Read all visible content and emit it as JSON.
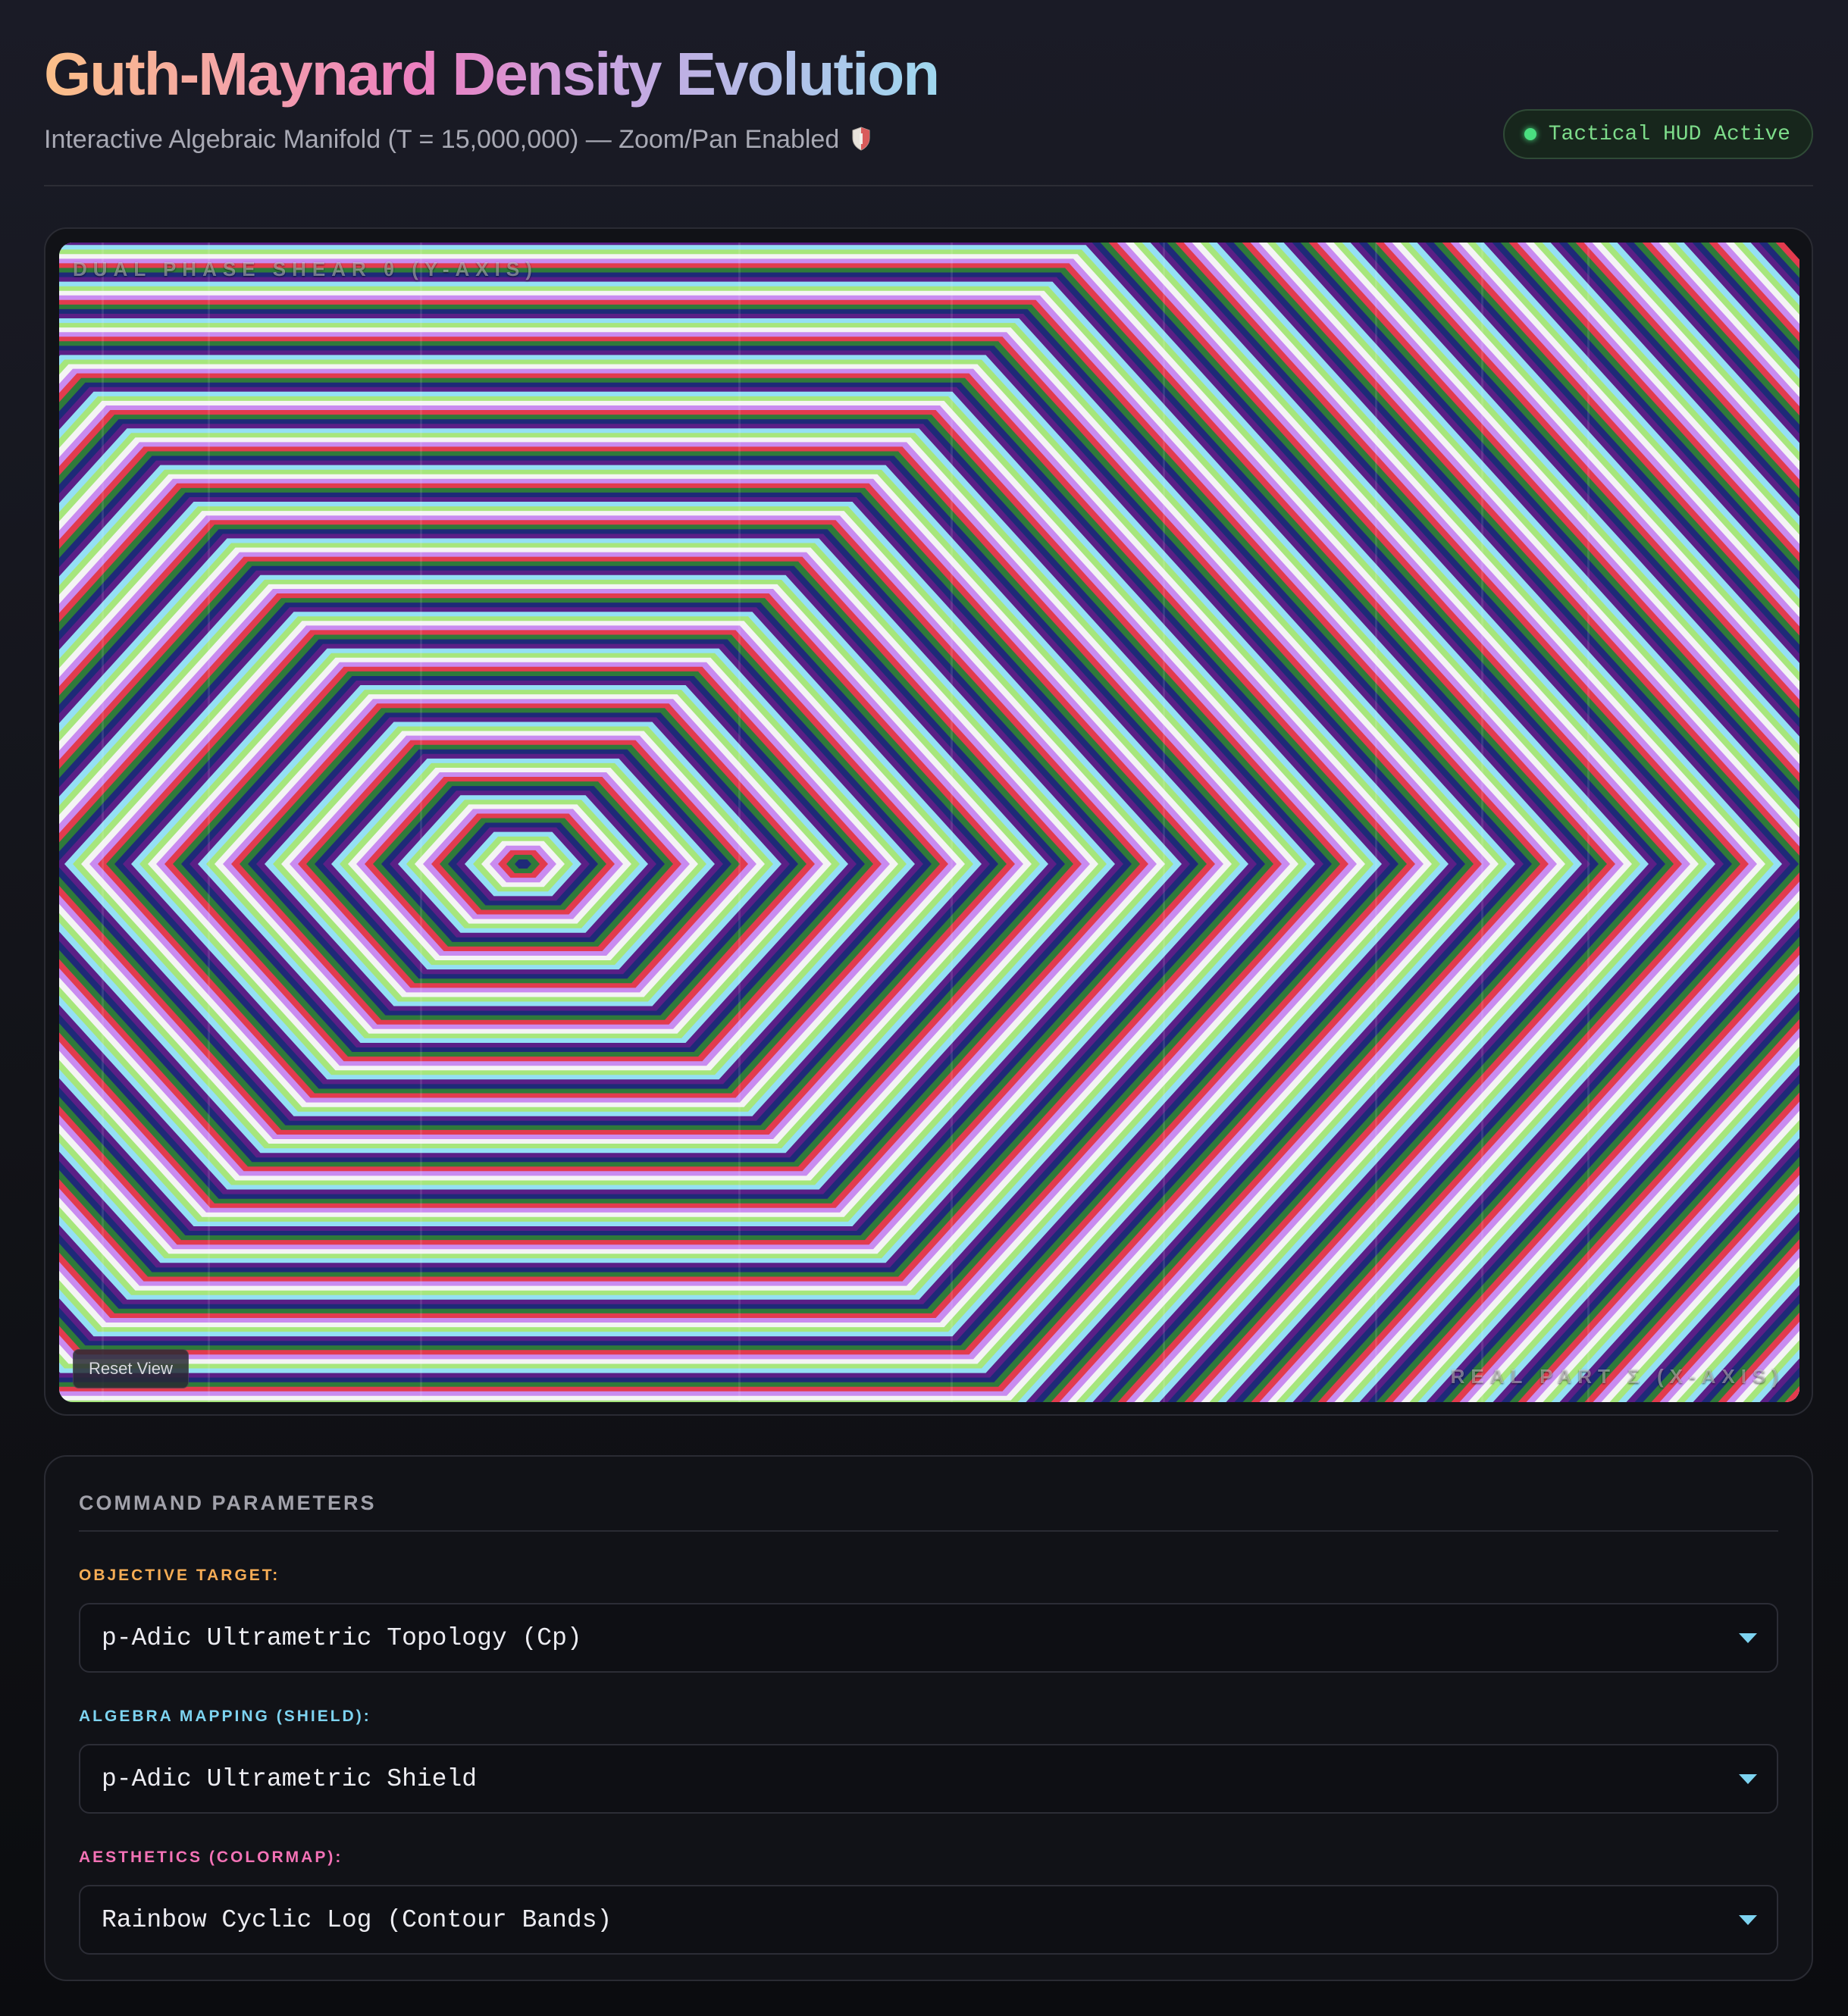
{
  "header": {
    "title": "Guth-Maynard Density Evolution",
    "subtitle": "Interactive Algebraic Manifold (T = 15,000,000) — Zoom/Pan Enabled",
    "subtitle_icon": "shield-icon",
    "status_badge": "Tactical HUD Active",
    "status_color": "#4ade80"
  },
  "visualization": {
    "y_axis_label": "DUAL PHASE SHEAR θ (Y-AXIS)",
    "x_axis_label": "REAL PART Σ (X-AXIS)",
    "reset_button": "Reset View",
    "palette": [
      "#1e2a78",
      "#2f7a3a",
      "#e23b4e",
      "#c98bf0",
      "#f4f4f4",
      "#a6e67c",
      "#94e0f4",
      "#5a1f86"
    ]
  },
  "parameters": {
    "section_title": "COMMAND PARAMETERS",
    "fields": [
      {
        "label": "OBJECTIVE TARGET:",
        "value": "p-Adic Ultrametric Topology (Cp)"
      },
      {
        "label": "ALGEBRA MAPPING (SHIELD):",
        "value": "p-Adic Ultrametric Shield"
      },
      {
        "label": "AESTHETICS (COLORMAP):",
        "value": "Rainbow Cyclic Log (Contour Bands)"
      }
    ]
  }
}
